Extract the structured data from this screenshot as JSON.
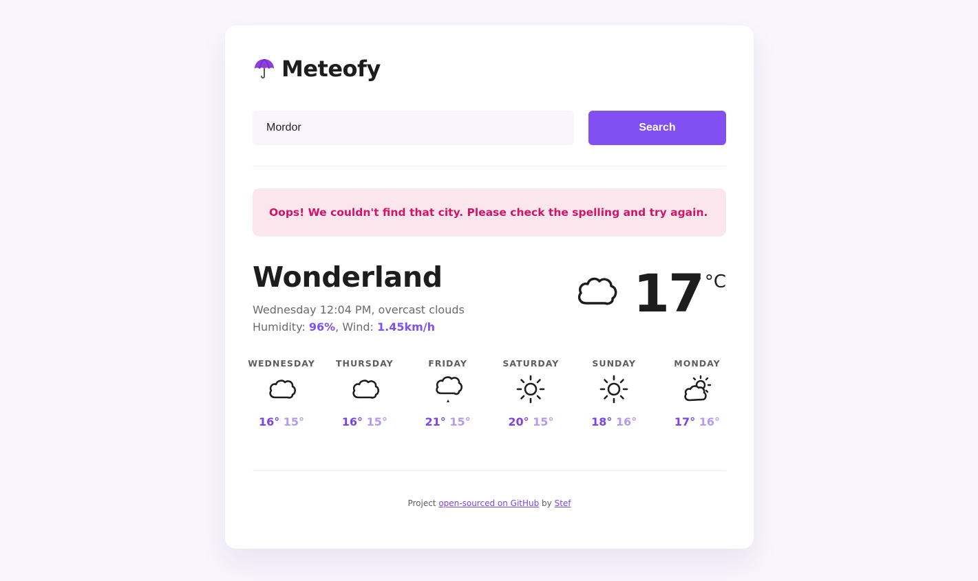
{
  "app": {
    "name": "Meteofy",
    "logo_icon": "umbrella-icon"
  },
  "search": {
    "value": "Mordor",
    "button_label": "Search"
  },
  "error": {
    "message": "Oops! We couldn't find that city. Please check the spelling and try again."
  },
  "current": {
    "city": "Wonderland",
    "description": "Wednesday 12:04 PM, overcast clouds",
    "humidity_label": "Humidity: ",
    "humidity_value": "96%",
    "wind_label": ", Wind: ",
    "wind_value": "1.45km/h",
    "temperature": "17",
    "unit": "°C",
    "icon": "cloud-icon"
  },
  "forecast": [
    {
      "day": "WEDNESDAY",
      "icon": "cloud-icon",
      "max": "16°",
      "min": "15°"
    },
    {
      "day": "THURSDAY",
      "icon": "cloud-icon",
      "max": "16°",
      "min": "15°"
    },
    {
      "day": "FRIDAY",
      "icon": "rain-cloud-icon",
      "max": "21°",
      "min": "15°"
    },
    {
      "day": "SATURDAY",
      "icon": "sun-icon",
      "max": "20°",
      "min": "15°"
    },
    {
      "day": "SUNDAY",
      "icon": "sun-icon",
      "max": "18°",
      "min": "16°"
    },
    {
      "day": "MONDAY",
      "icon": "partly-cloudy-icon",
      "max": "17°",
      "min": "16°"
    }
  ],
  "footer": {
    "prefix": "Project ",
    "link_text": "open-sourced on GitHub",
    "middle": " by ",
    "author": "Stef"
  },
  "colors": {
    "accent": "#8250f2",
    "error_text": "#d21467",
    "error_bg": "#fce6ee",
    "background": "#f8f5fd"
  }
}
